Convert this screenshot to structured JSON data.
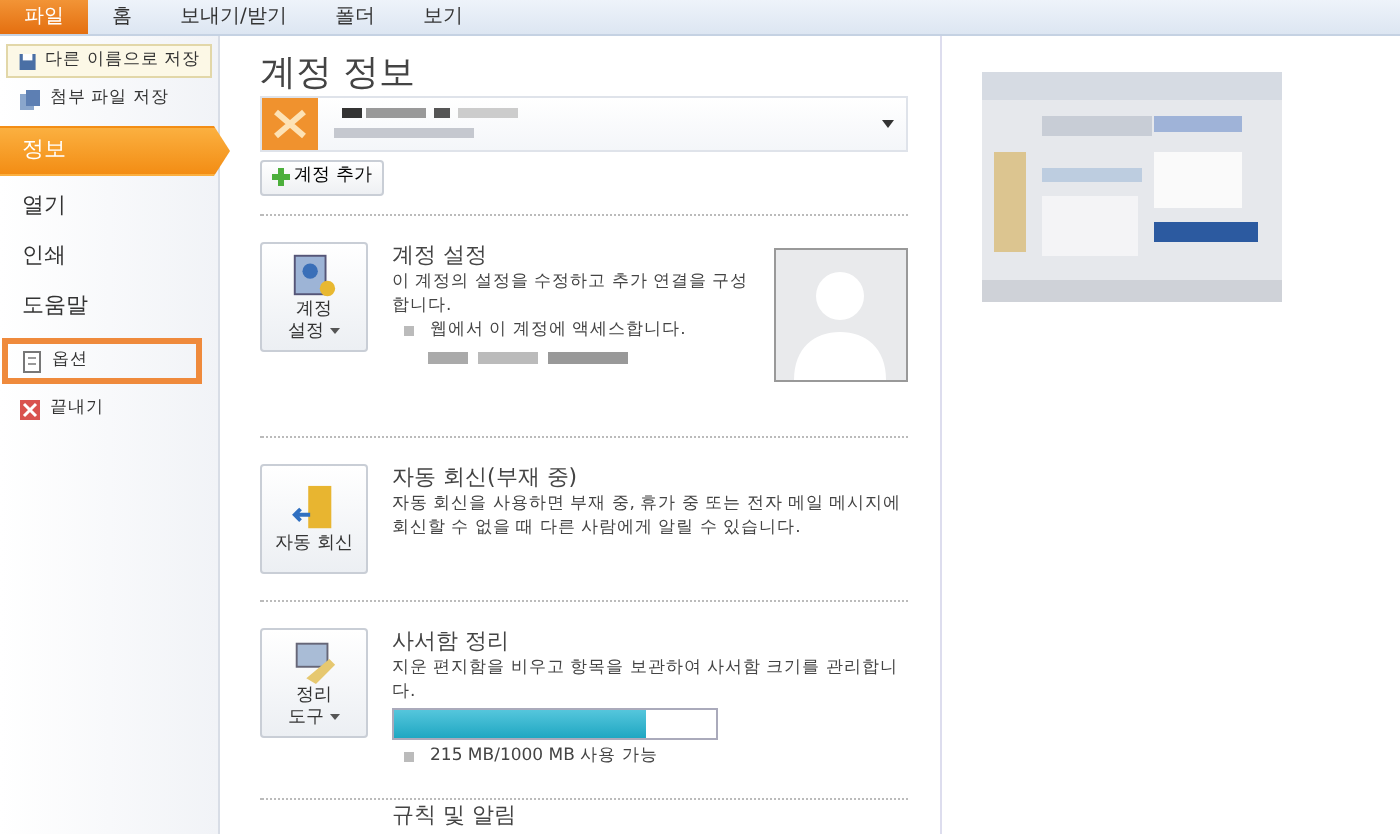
{
  "ribbon_tabs": [
    {
      "label": "파일",
      "selected": true
    },
    {
      "label": "홈",
      "selected": false
    },
    {
      "label": "보내기/받기",
      "selected": false
    },
    {
      "label": "폴더",
      "selected": false
    },
    {
      "label": "보기",
      "selected": false
    }
  ],
  "sidebar": {
    "items": [
      {
        "label": "다른 이름으로 저장",
        "kind": "command",
        "selected": false,
        "highlighted": false
      },
      {
        "label": "첨부 파일 저장",
        "kind": "command",
        "selected": false,
        "highlighted": false
      },
      {
        "label": "정보",
        "kind": "page",
        "selected": true,
        "highlighted": false
      },
      {
        "label": "열기",
        "kind": "page",
        "selected": false,
        "highlighted": false
      },
      {
        "label": "인쇄",
        "kind": "page",
        "selected": false,
        "highlighted": false
      },
      {
        "label": "도움말",
        "kind": "page",
        "selected": false,
        "highlighted": false
      },
      {
        "label": "옵션",
        "kind": "command",
        "selected": false,
        "highlighted": true
      },
      {
        "label": "끝내기",
        "kind": "command",
        "selected": false,
        "highlighted": false
      }
    ]
  },
  "main": {
    "title": "계정 정보",
    "add_account_button": "계정 추가",
    "sections": [
      {
        "kind": "account",
        "button": [
          "계정",
          "설정"
        ],
        "has_menu": true,
        "title": "계정 설정",
        "description": "이 계정의 설정을 수정하고 추가 연결을 구성합니다.",
        "bullet": "웹에서 이 계정에 액세스합니다."
      },
      {
        "kind": "autoreply",
        "button": [
          "자동 회신"
        ],
        "has_menu": false,
        "title": "자동 회신(부재 중)",
        "description": "자동 회신을 사용하면 부재 중, 휴가 중 또는 전자 메일 메시지에 회신할 수 없을 때 다른 사람에게 알릴 수 있습니다."
      },
      {
        "kind": "cleanup",
        "button": [
          "정리",
          "도구"
        ],
        "has_menu": true,
        "title": "사서함 정리",
        "description": "지운 편지함을 비우고 항목을 보관하여 사서함 크기를 관리합니다.",
        "storage": {
          "level": 0.78,
          "reading": "215 MB/1000 MB 사용 가능"
        }
      },
      {
        "kind": "rules",
        "title": "규칙 및 알림"
      }
    ]
  }
}
